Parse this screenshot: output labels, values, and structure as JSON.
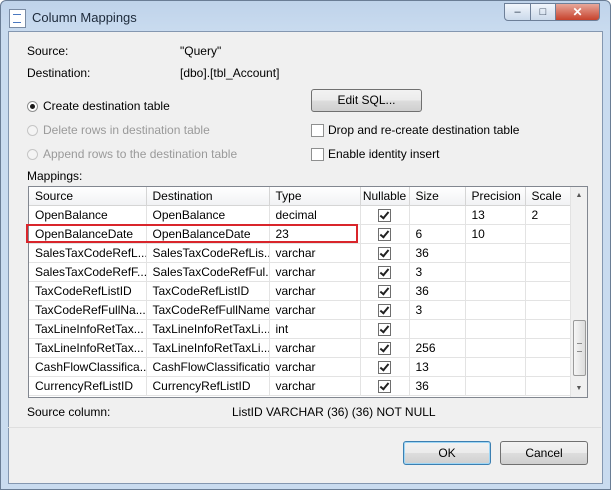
{
  "window": {
    "title": "Column Mappings",
    "controls": {
      "minimize": "–",
      "maximize": "□",
      "close": "✕"
    }
  },
  "info": {
    "source_label": "Source:",
    "source_value": "\"Query\"",
    "destination_label": "Destination:",
    "destination_value": "[dbo].[tbl_Account]"
  },
  "options": {
    "create_table": {
      "label": "Create destination table",
      "checked": true,
      "enabled": true
    },
    "delete_rows": {
      "label": "Delete rows in destination table",
      "checked": false,
      "enabled": false
    },
    "append_rows": {
      "label": "Append rows to the destination table",
      "checked": false,
      "enabled": false
    },
    "edit_sql_label": "Edit SQL...",
    "drop_recreate": {
      "label": "Drop and re-create destination table",
      "checked": false
    },
    "identity_insert": {
      "label": "Enable identity insert",
      "checked": false
    }
  },
  "mappings": {
    "label": "Mappings:",
    "columns": [
      "Source",
      "Destination",
      "Type",
      "Nullable",
      "Size",
      "Precision",
      "Scale"
    ],
    "rows": [
      {
        "source": "OpenBalance",
        "destination": "OpenBalance",
        "type": "decimal",
        "nullable": true,
        "size": "",
        "precision": "13",
        "scale": "2"
      },
      {
        "source": "OpenBalanceDate",
        "destination": "OpenBalanceDate",
        "type": "23",
        "nullable": true,
        "size": "6",
        "precision": "10",
        "scale": ""
      },
      {
        "source": "SalesTaxCodeRefL...",
        "destination": "SalesTaxCodeRefLis...",
        "type": "varchar",
        "nullable": true,
        "size": "36",
        "precision": "",
        "scale": ""
      },
      {
        "source": "SalesTaxCodeRefF...",
        "destination": "SalesTaxCodeRefFul...",
        "type": "varchar",
        "nullable": true,
        "size": "3",
        "precision": "",
        "scale": ""
      },
      {
        "source": "TaxCodeRefListID",
        "destination": "TaxCodeRefListID",
        "type": "varchar",
        "nullable": true,
        "size": "36",
        "precision": "",
        "scale": ""
      },
      {
        "source": "TaxCodeRefFullNa...",
        "destination": "TaxCodeRefFullName",
        "type": "varchar",
        "nullable": true,
        "size": "3",
        "precision": "",
        "scale": ""
      },
      {
        "source": "TaxLineInfoRetTax...",
        "destination": "TaxLineInfoRetTaxLi...",
        "type": "int",
        "nullable": true,
        "size": "",
        "precision": "",
        "scale": ""
      },
      {
        "source": "TaxLineInfoRetTax...",
        "destination": "TaxLineInfoRetTaxLi...",
        "type": "varchar",
        "nullable": true,
        "size": "256",
        "precision": "",
        "scale": ""
      },
      {
        "source": "CashFlowClassifica...",
        "destination": "CashFlowClassification",
        "type": "varchar",
        "nullable": true,
        "size": "13",
        "precision": "",
        "scale": ""
      },
      {
        "source": "CurrencyRefListID",
        "destination": "CurrencyRefListID",
        "type": "varchar",
        "nullable": true,
        "size": "36",
        "precision": "",
        "scale": ""
      }
    ]
  },
  "source_column": {
    "label": "Source column:",
    "value": "ListID VARCHAR (36) (36) NOT NULL"
  },
  "buttons": {
    "ok": "OK",
    "cancel": "Cancel"
  },
  "colors": {
    "highlight": "#d9252b",
    "title_bar": "#c9dbef",
    "dialog_bg": "#f0f0f0"
  }
}
